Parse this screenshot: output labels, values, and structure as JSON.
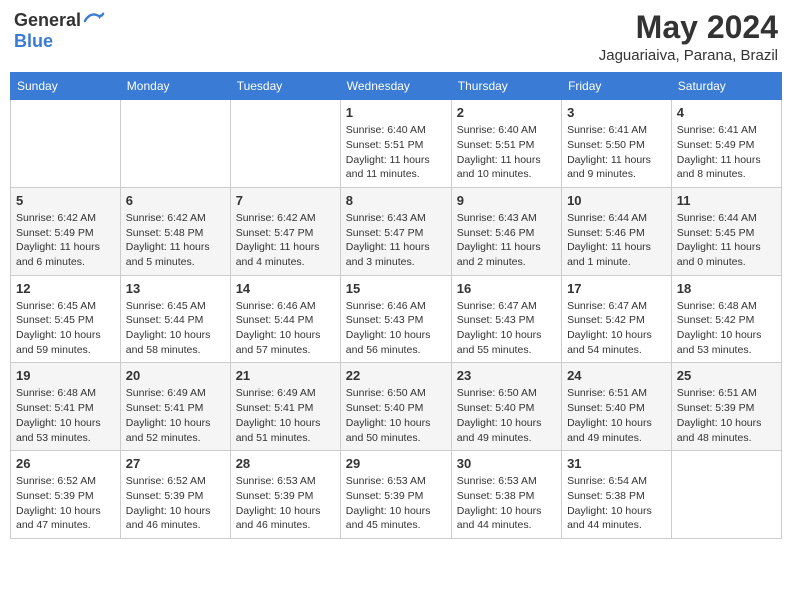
{
  "header": {
    "logo_general": "General",
    "logo_blue": "Blue",
    "month": "May 2024",
    "location": "Jaguariaiva, Parana, Brazil"
  },
  "days_of_week": [
    "Sunday",
    "Monday",
    "Tuesday",
    "Wednesday",
    "Thursday",
    "Friday",
    "Saturday"
  ],
  "weeks": [
    [
      {
        "day": "",
        "info": ""
      },
      {
        "day": "",
        "info": ""
      },
      {
        "day": "",
        "info": ""
      },
      {
        "day": "1",
        "info": "Sunrise: 6:40 AM\nSunset: 5:51 PM\nDaylight: 11 hours and 11 minutes."
      },
      {
        "day": "2",
        "info": "Sunrise: 6:40 AM\nSunset: 5:51 PM\nDaylight: 11 hours and 10 minutes."
      },
      {
        "day": "3",
        "info": "Sunrise: 6:41 AM\nSunset: 5:50 PM\nDaylight: 11 hours and 9 minutes."
      },
      {
        "day": "4",
        "info": "Sunrise: 6:41 AM\nSunset: 5:49 PM\nDaylight: 11 hours and 8 minutes."
      }
    ],
    [
      {
        "day": "5",
        "info": "Sunrise: 6:42 AM\nSunset: 5:49 PM\nDaylight: 11 hours and 6 minutes."
      },
      {
        "day": "6",
        "info": "Sunrise: 6:42 AM\nSunset: 5:48 PM\nDaylight: 11 hours and 5 minutes."
      },
      {
        "day": "7",
        "info": "Sunrise: 6:42 AM\nSunset: 5:47 PM\nDaylight: 11 hours and 4 minutes."
      },
      {
        "day": "8",
        "info": "Sunrise: 6:43 AM\nSunset: 5:47 PM\nDaylight: 11 hours and 3 minutes."
      },
      {
        "day": "9",
        "info": "Sunrise: 6:43 AM\nSunset: 5:46 PM\nDaylight: 11 hours and 2 minutes."
      },
      {
        "day": "10",
        "info": "Sunrise: 6:44 AM\nSunset: 5:46 PM\nDaylight: 11 hours and 1 minute."
      },
      {
        "day": "11",
        "info": "Sunrise: 6:44 AM\nSunset: 5:45 PM\nDaylight: 11 hours and 0 minutes."
      }
    ],
    [
      {
        "day": "12",
        "info": "Sunrise: 6:45 AM\nSunset: 5:45 PM\nDaylight: 10 hours and 59 minutes."
      },
      {
        "day": "13",
        "info": "Sunrise: 6:45 AM\nSunset: 5:44 PM\nDaylight: 10 hours and 58 minutes."
      },
      {
        "day": "14",
        "info": "Sunrise: 6:46 AM\nSunset: 5:44 PM\nDaylight: 10 hours and 57 minutes."
      },
      {
        "day": "15",
        "info": "Sunrise: 6:46 AM\nSunset: 5:43 PM\nDaylight: 10 hours and 56 minutes."
      },
      {
        "day": "16",
        "info": "Sunrise: 6:47 AM\nSunset: 5:43 PM\nDaylight: 10 hours and 55 minutes."
      },
      {
        "day": "17",
        "info": "Sunrise: 6:47 AM\nSunset: 5:42 PM\nDaylight: 10 hours and 54 minutes."
      },
      {
        "day": "18",
        "info": "Sunrise: 6:48 AM\nSunset: 5:42 PM\nDaylight: 10 hours and 53 minutes."
      }
    ],
    [
      {
        "day": "19",
        "info": "Sunrise: 6:48 AM\nSunset: 5:41 PM\nDaylight: 10 hours and 53 minutes."
      },
      {
        "day": "20",
        "info": "Sunrise: 6:49 AM\nSunset: 5:41 PM\nDaylight: 10 hours and 52 minutes."
      },
      {
        "day": "21",
        "info": "Sunrise: 6:49 AM\nSunset: 5:41 PM\nDaylight: 10 hours and 51 minutes."
      },
      {
        "day": "22",
        "info": "Sunrise: 6:50 AM\nSunset: 5:40 PM\nDaylight: 10 hours and 50 minutes."
      },
      {
        "day": "23",
        "info": "Sunrise: 6:50 AM\nSunset: 5:40 PM\nDaylight: 10 hours and 49 minutes."
      },
      {
        "day": "24",
        "info": "Sunrise: 6:51 AM\nSunset: 5:40 PM\nDaylight: 10 hours and 49 minutes."
      },
      {
        "day": "25",
        "info": "Sunrise: 6:51 AM\nSunset: 5:39 PM\nDaylight: 10 hours and 48 minutes."
      }
    ],
    [
      {
        "day": "26",
        "info": "Sunrise: 6:52 AM\nSunset: 5:39 PM\nDaylight: 10 hours and 47 minutes."
      },
      {
        "day": "27",
        "info": "Sunrise: 6:52 AM\nSunset: 5:39 PM\nDaylight: 10 hours and 46 minutes."
      },
      {
        "day": "28",
        "info": "Sunrise: 6:53 AM\nSunset: 5:39 PM\nDaylight: 10 hours and 46 minutes."
      },
      {
        "day": "29",
        "info": "Sunrise: 6:53 AM\nSunset: 5:39 PM\nDaylight: 10 hours and 45 minutes."
      },
      {
        "day": "30",
        "info": "Sunrise: 6:53 AM\nSunset: 5:38 PM\nDaylight: 10 hours and 44 minutes."
      },
      {
        "day": "31",
        "info": "Sunrise: 6:54 AM\nSunset: 5:38 PM\nDaylight: 10 hours and 44 minutes."
      },
      {
        "day": "",
        "info": ""
      }
    ]
  ]
}
